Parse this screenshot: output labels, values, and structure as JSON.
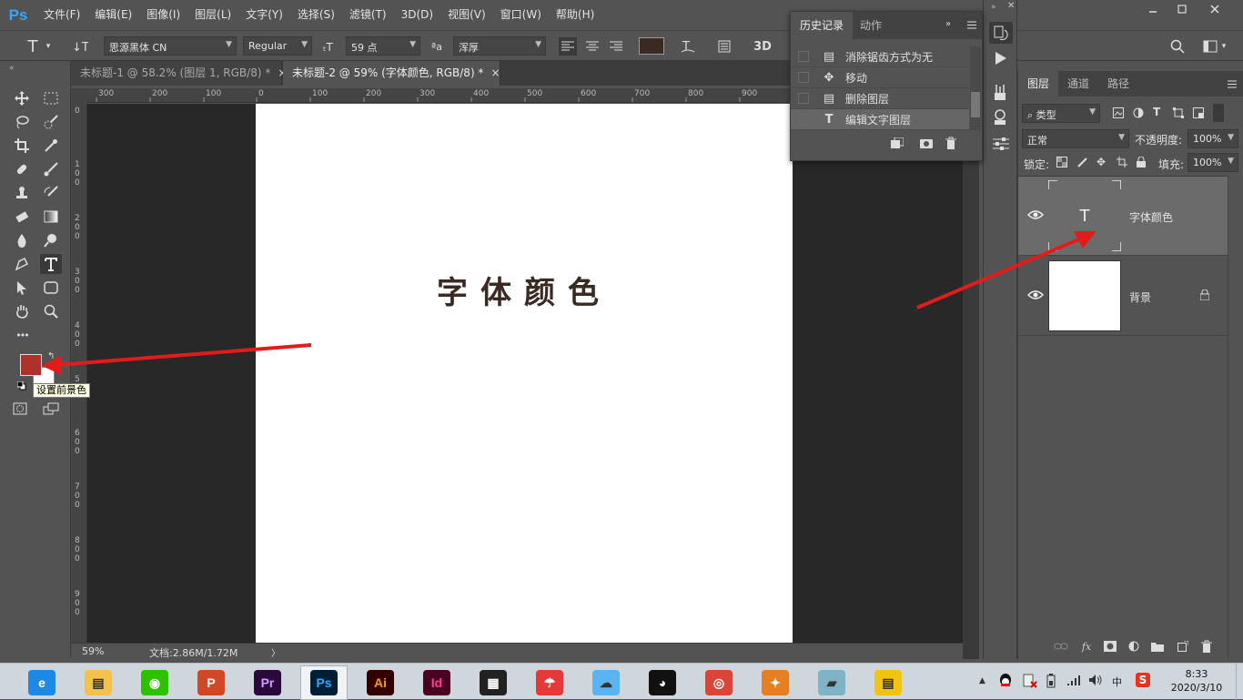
{
  "app": {
    "logo": "Ps",
    "accent": "#31a8ff"
  },
  "menu": [
    "文件(F)",
    "编辑(E)",
    "图像(I)",
    "图层(L)",
    "文字(Y)",
    "选择(S)",
    "滤镜(T)",
    "3D(D)",
    "视图(V)",
    "窗口(W)",
    "帮助(H)"
  ],
  "options": {
    "font_family": "思源黑体 CN",
    "font_style": "Regular",
    "font_size": "59 点",
    "antialias": "浑厚",
    "aa_label": "ªa",
    "three_d": "3D",
    "text_color": "#3b2a22"
  },
  "tabs": [
    {
      "label": "未标题-1 @ 58.2% (图层 1, RGB/8) *",
      "close": "×"
    },
    {
      "label": "未标题-2 @ 59% (字体颜色, RGB/8) *",
      "close": "×"
    }
  ],
  "ruler": {
    "h": [
      "300",
      "200",
      "100",
      "0",
      "100",
      "200",
      "300",
      "400",
      "500",
      "600",
      "700",
      "800",
      "900"
    ],
    "v": [
      "0",
      "1\n0\n0",
      "2\n0\n0",
      "3\n0\n0",
      "4\n0\n0",
      "5",
      "6\n0\n0",
      "7\n0\n0",
      "8\n0\n0",
      "9\n0\n0"
    ]
  },
  "canvas": {
    "text": "字体颜色",
    "text_color": "#3b2a22"
  },
  "status": {
    "zoom": "59%",
    "doc": "文档:2.86M/1.72M",
    "arrow": "〉"
  },
  "toolbox": {
    "foreground_color": "#b0302c",
    "background_color": "#ffffff",
    "tooltip": "设置前景色",
    "more": "•••"
  },
  "history": {
    "tabs": [
      "历史记录",
      "动作"
    ],
    "items": [
      "消除锯齿方式为无",
      "移动",
      "删除图层",
      "编辑文字图层"
    ]
  },
  "layers": {
    "tabs": [
      "图层",
      "通道",
      "路径"
    ],
    "filter": "类型",
    "blend_mode": "正常",
    "opacity_label": "不透明度:",
    "opacity": "100%",
    "lock_label": "锁定:",
    "fill_label": "填充:",
    "fill": "100%",
    "items": [
      {
        "name": "字体颜色",
        "type": "text",
        "thumb_glyph": "T"
      },
      {
        "name": "背景",
        "type": "pixel"
      }
    ],
    "fx": "fx"
  },
  "taskbar": {
    "apps": [
      {
        "name": "ie",
        "label": "e",
        "color": "#1e88e5"
      },
      {
        "name": "explorer",
        "label": "▤",
        "color": "#f2c14e"
      },
      {
        "name": "wechat",
        "label": "◉",
        "color": "#2dc100"
      },
      {
        "name": "powerpoint",
        "label": "P",
        "color": "#d24726"
      },
      {
        "name": "premiere",
        "label": "Pr",
        "color": "#2a0a3d"
      },
      {
        "name": "photoshop",
        "label": "Ps",
        "color": "#001e36"
      },
      {
        "name": "illustrator",
        "label": "Ai",
        "color": "#330000"
      },
      {
        "name": "indesign",
        "label": "Id",
        "color": "#49021f"
      },
      {
        "name": "video",
        "label": "▦",
        "color": "#222"
      },
      {
        "name": "umbrella",
        "label": "☂",
        "color": "#e63939"
      },
      {
        "name": "cloud",
        "label": "☁",
        "color": "#5ab4f0"
      },
      {
        "name": "qq",
        "label": "◕",
        "color": "#111"
      },
      {
        "name": "chrome",
        "label": "◎",
        "color": "#db4437"
      },
      {
        "name": "fox",
        "label": "✦",
        "color": "#e67e22"
      },
      {
        "name": "book",
        "label": "▰",
        "color": "#7fb3c8"
      },
      {
        "name": "notes",
        "label": "▤",
        "color": "#f1c40f"
      }
    ],
    "tray_ime": "中",
    "tray_s": "S",
    "time": "8:33",
    "date": "2020/3/10"
  }
}
